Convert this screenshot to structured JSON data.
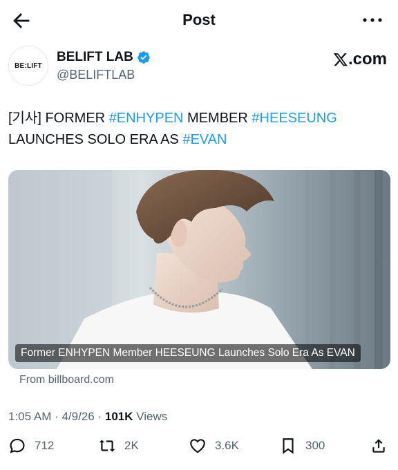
{
  "header": {
    "title": "Post"
  },
  "author": {
    "avatar_text": "BE:LIFT",
    "name": "BELIFT LAB",
    "handle": "@BELIFTLAB",
    "source_logo": ".com"
  },
  "tweet": {
    "prefix": "[기사] FORMER ",
    "tag1": "#ENHYPEN",
    "mid1": " MEMBER ",
    "tag2": "#HEESEUNG",
    "mid2": "LAUNCHES SOLO ERA AS ",
    "tag3": "#EVAN"
  },
  "card": {
    "caption": "Former ENHYPEN Member HEESEUNG Launches Solo Era As EVAN",
    "source": "From billboard.com"
  },
  "meta": {
    "time": "1:05 AM · 4/9/26 · ",
    "views_count": "101K",
    "views_label": " Views"
  },
  "actions": {
    "replies": "712",
    "reposts": "2K",
    "likes": "3.6K",
    "bookmarks": "300"
  },
  "colors": {
    "accent": "#1d9bf0",
    "text": "#0f1419",
    "muted": "#536471"
  }
}
